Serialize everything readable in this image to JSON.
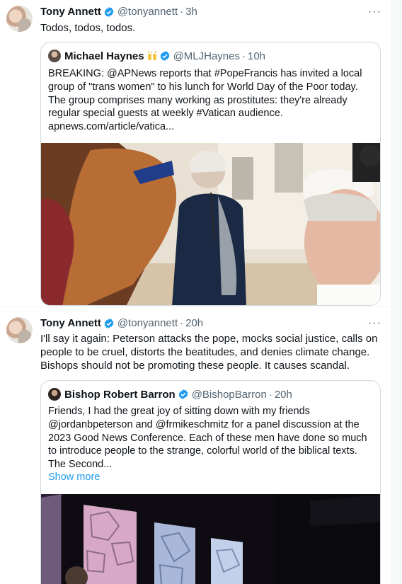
{
  "tweets": [
    {
      "author": {
        "name": "Tony Annett",
        "handle": "@tonyannett",
        "time": "3h"
      },
      "text": "Todos, todos, todos.",
      "quoted": {
        "author": {
          "name": "Michael Haynes",
          "handle": "@MLJHaynes",
          "time": "10h"
        },
        "lines": [
          "BREAKING: @APNews reports that #PopeFrancis has invited a local",
          "group of \"trans women\" to his lunch for World Day of the Poor today.",
          "The group comprises many working as prostitutes: they're already",
          "regular special guests at weekly #Vatican audience.",
          "apnews.com/article/vatica..."
        ]
      }
    },
    {
      "author": {
        "name": "Tony Annett",
        "handle": "@tonyannett",
        "time": "20h"
      },
      "lines": [
        "I'll say it again: Peterson attacks the pope, mocks social justice, calls on",
        "people to be cruel, distorts the beatitudes, and denies climate change.",
        "Bishops should not be promoting these people. It causes scandal."
      ],
      "quoted": {
        "author": {
          "name": "Bishop Robert Barron",
          "handle": "@BishopBarron",
          "time": "20h"
        },
        "lines": [
          "Friends, I had the great joy of sitting down with my friends",
          "@jordanbpeterson and @frmikeschmitz for a panel discussion at the",
          "2023 Good News Conference. Each of these men have done so much",
          "to introduce people to the strange, colorful world of the biblical texts.",
          "The Second..."
        ],
        "show_more": "Show more"
      }
    }
  ],
  "ui": {
    "separator": "·",
    "more_glyph": "···"
  },
  "icons": {
    "verified": "verified-badge-icon",
    "more": "more-options-icon",
    "emoji": "raised-hands-emoji"
  },
  "colors": {
    "link": "#1d9bf0",
    "secondary": "#536471",
    "border": "#cfd9de",
    "verified": "#1d9bf0"
  }
}
